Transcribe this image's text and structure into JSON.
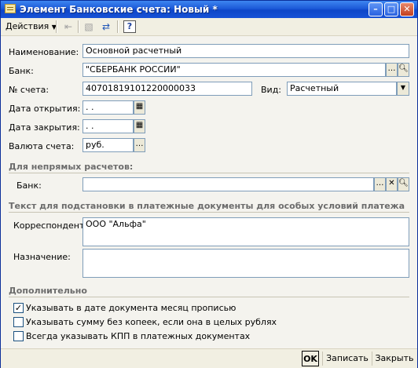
{
  "window": {
    "title": "Элемент Банковские счета: Новый *"
  },
  "toolbar": {
    "actions_label": "Действия"
  },
  "form": {
    "name_label": "Наименование:",
    "name_value": "Основной расчетный",
    "bank_label": "Банк:",
    "bank_value": "\"СБЕРБАНК РОССИИ\"",
    "account_label": "№ счета:",
    "account_value": "40701819101220000033",
    "kind_label": "Вид:",
    "kind_value": "Расчетный",
    "open_date_label": "Дата открытия:",
    "open_date_value": " .  .",
    "close_date_label": "Дата закрытия:",
    "close_date_value": " .  .",
    "currency_label": "Валюта счета:",
    "currency_value": "руб."
  },
  "indirect": {
    "section_title": "Для непрямых расчетов:",
    "bank_label": "Банк:",
    "bank_value": ""
  },
  "paydocs": {
    "section_title": "Текст для подстановки в платежные документы для особых условий платежа",
    "correspondent_label": "Корреспондент:",
    "correspondent_value": "ООО \"Альфа\"",
    "purpose_label": "Назначение:",
    "purpose_value": ""
  },
  "extra": {
    "section_title": "Дополнительно",
    "options": [
      {
        "label": "Указывать в дате документа месяц прописью",
        "checked": true
      },
      {
        "label": "Указывать сумму без копеек, если она в целых рублях",
        "checked": false
      },
      {
        "label": "Всегда указывать КПП в платежных документах",
        "checked": false
      }
    ]
  },
  "buttons": {
    "ok": "OK",
    "save": "Записать",
    "close": "Закрыть"
  }
}
